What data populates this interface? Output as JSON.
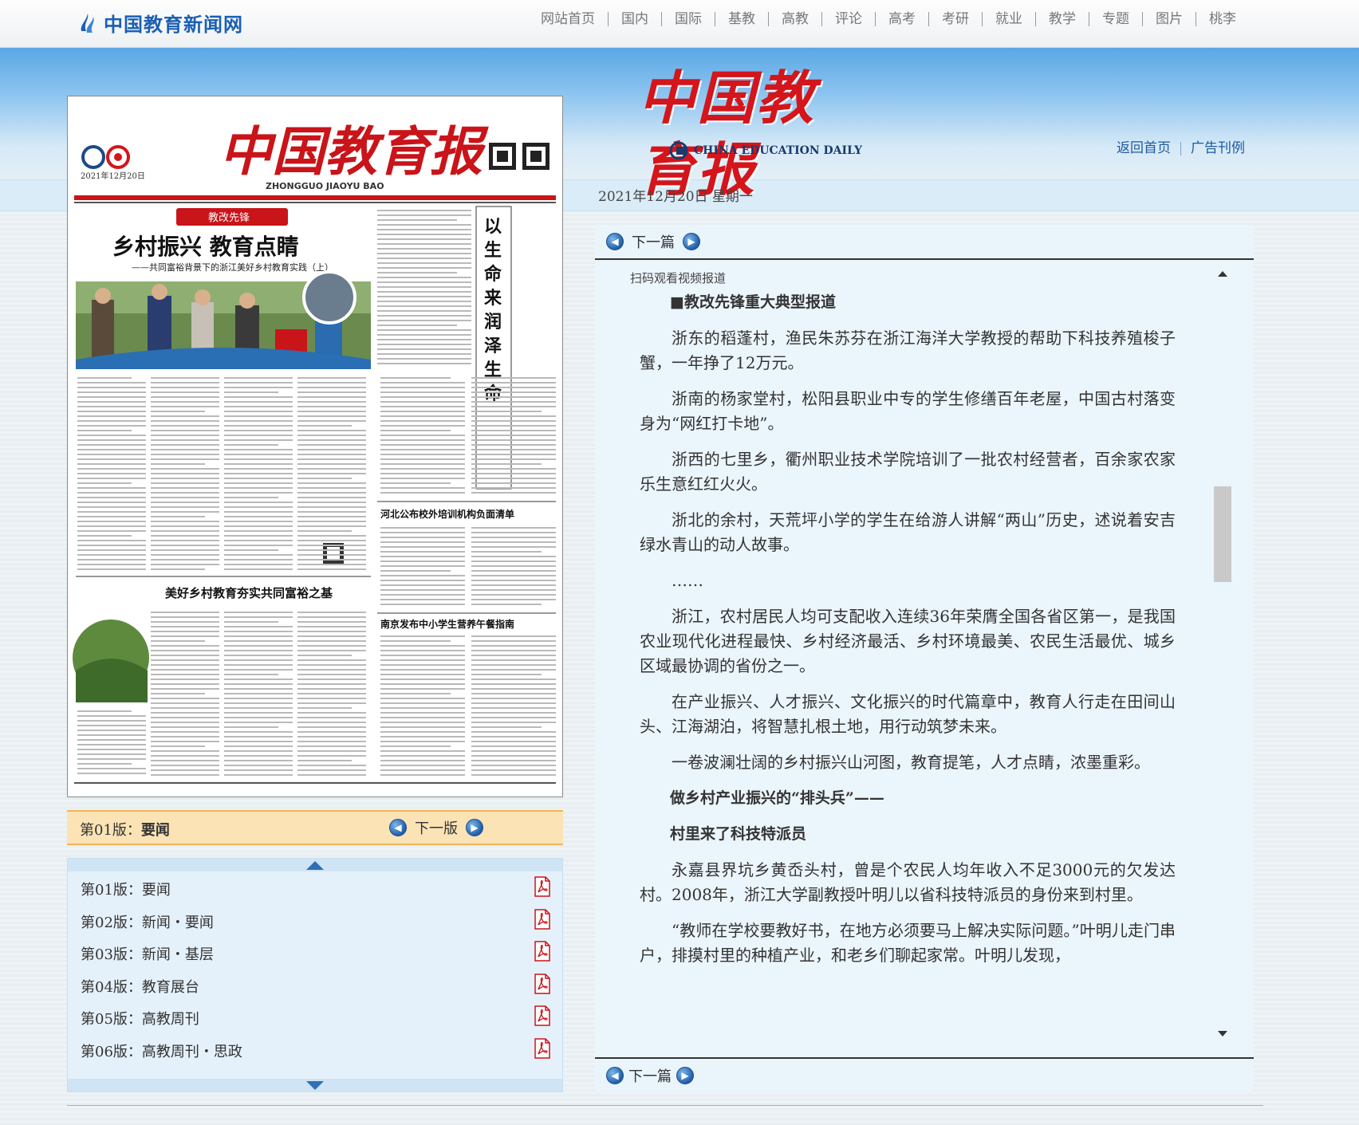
{
  "site": {
    "logo_text": "中国教育新闻网"
  },
  "topnav": [
    "网站首页",
    "国内",
    "国际",
    "基教",
    "高教",
    "评论",
    "高考",
    "考研",
    "就业",
    "教学",
    "专题",
    "图片",
    "桃李"
  ],
  "masthead": {
    "cn": "中国教育报",
    "en": "CHINA EDUCATION DAILY"
  },
  "head_links": [
    "返回首页",
    "广告刊例"
  ],
  "date": "2021年12月20日  星期一",
  "paper": {
    "masthead": "中国教育报",
    "pinyin": "ZHONGGUO JIAOYU BAO",
    "date": "2021年12月20日",
    "tag": "教改先锋",
    "headline": "乡村振兴 教育点睛",
    "subhead": "——共同富裕背景下的浙江美好乡村教育实践（上）",
    "side_title": "以生命来润泽生命",
    "mid_title": "美好乡村教育夯实共同富裕之基",
    "right_title_1": "河北公布校外培训机构负面清单",
    "right_title_2": "南京发布中小学生营养午餐指南"
  },
  "edition_bar": {
    "current_prefix": "第01版：",
    "current_name": "要闻",
    "next_label": "下一版"
  },
  "editions": [
    {
      "label": "第01版：要闻"
    },
    {
      "label": "第02版：新闻・要闻"
    },
    {
      "label": "第03版：新闻・基层"
    },
    {
      "label": "第04版：教育展台"
    },
    {
      "label": "第05版：高教周刊"
    },
    {
      "label": "第06版：高教周刊・思政"
    }
  ],
  "article_nav": {
    "next_label": "下一篇"
  },
  "article": {
    "video_note": "扫码观看视频报道",
    "paragraphs": [
      {
        "text": "■教改先锋重大典型报道",
        "head": true
      },
      {
        "text": "浙东的稻蓬村，渔民朱苏芬在浙江海洋大学教授的帮助下科技养殖梭子蟹，一年挣了12万元。"
      },
      {
        "text": "浙南的杨家堂村，松阳县职业中专的学生修缮百年老屋，中国古村落变身为“网红打卡地”。"
      },
      {
        "text": "浙西的七里乡，衢州职业技术学院培训了一批农村经营者，百余家农家乐生意红红火火。"
      },
      {
        "text": "浙北的余村，天荒坪小学的学生在给游人讲解“两山”历史，述说着安吉绿水青山的动人故事。"
      },
      {
        "text": "……"
      },
      {
        "text": "浙江，农村居民人均可支配收入连续36年荣膺全国各省区第一，是我国农业现代化进程最快、乡村经济最活、乡村环境最美、农民生活最优、城乡区域最协调的省份之一。"
      },
      {
        "text": "在产业振兴、人才振兴、文化振兴的时代篇章中，教育人行走在田间山头、江海湖泊，将智慧扎根土地，用行动筑梦未来。"
      },
      {
        "text": "一卷波澜壮阔的乡村振兴山河图，教育提笔，人才点睛，浓墨重彩。"
      },
      {
        "text": "做乡村产业振兴的“排头兵”——",
        "head": true
      },
      {
        "text": "村里来了科技特派员",
        "head": true
      },
      {
        "text": "永嘉县界坑乡黄岙头村，曾是个农民人均年收入不足3000元的欠发达村。2008年，浙江大学副教授叶明儿以省科技特派员的身份来到村里。"
      },
      {
        "text": "“教师在学校要教好书，在地方必须要马上解决实际问题。”叶明儿走门串户，排摸村里的种植产业，和老乡们聊起家常。叶明儿发现，"
      }
    ]
  },
  "colors": {
    "accent_red": "#d4151b",
    "link_blue": "#1d5aa0",
    "edition_bar": "#fbe3b6"
  }
}
